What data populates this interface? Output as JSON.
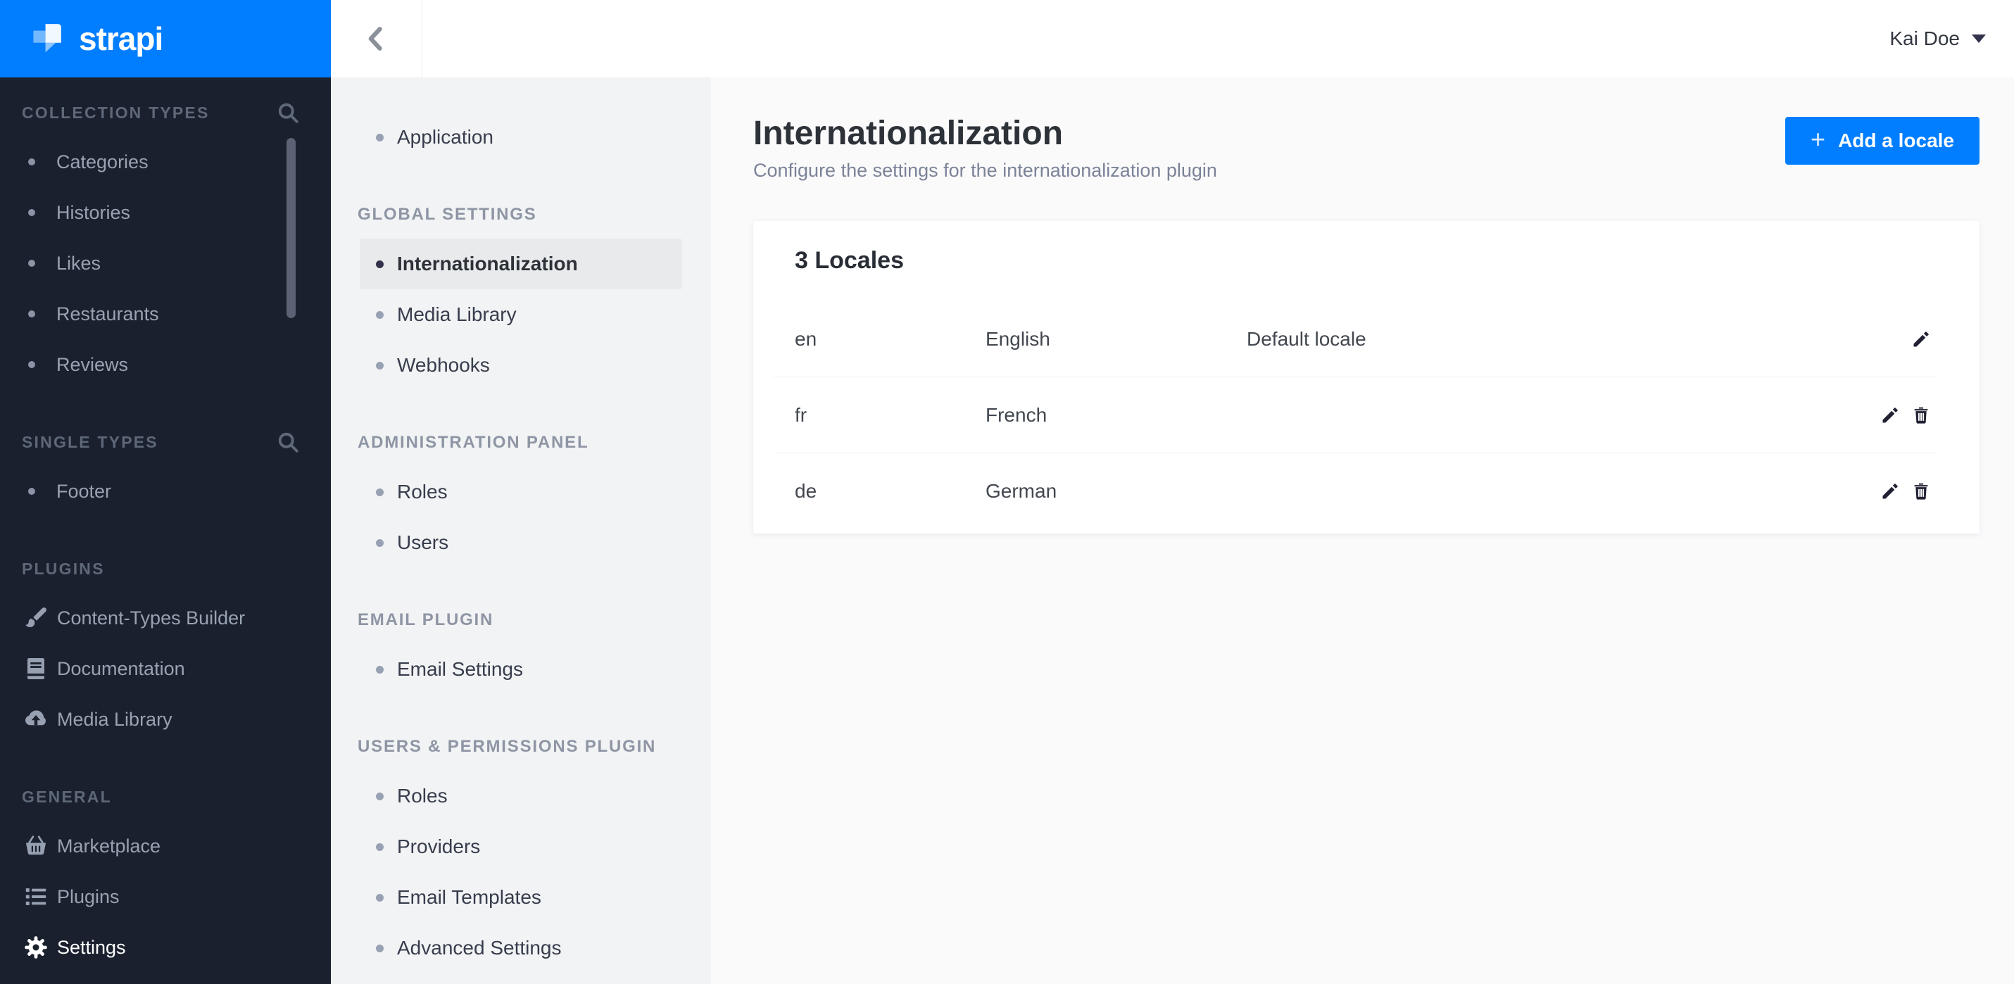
{
  "brand": {
    "name": "strapi"
  },
  "header": {
    "user": "Kai Doe"
  },
  "sidebar": {
    "sections": [
      {
        "label": "COLLECTION TYPES",
        "search_icon": "search-icon",
        "items": [
          {
            "label": "Categories"
          },
          {
            "label": "Histories"
          },
          {
            "label": "Likes"
          },
          {
            "label": "Restaurants"
          },
          {
            "label": "Reviews"
          }
        ]
      },
      {
        "label": "SINGLE TYPES",
        "search_icon": "search-icon",
        "items": [
          {
            "label": "Footer"
          }
        ]
      },
      {
        "label": "PLUGINS",
        "items": [
          {
            "label": "Content-Types Builder",
            "icon": "paintbrush-icon"
          },
          {
            "label": "Documentation",
            "icon": "book-icon"
          },
          {
            "label": "Media Library",
            "icon": "cloud-upload-icon"
          }
        ]
      },
      {
        "label": "GENERAL",
        "items": [
          {
            "label": "Marketplace",
            "icon": "basket-icon"
          },
          {
            "label": "Plugins",
            "icon": "list-icon"
          },
          {
            "label": "Settings",
            "icon": "gear-icon",
            "active": true
          }
        ]
      }
    ]
  },
  "settings_nav": {
    "top_item": {
      "label": "Application"
    },
    "sections": [
      {
        "label": "GLOBAL SETTINGS",
        "items": [
          {
            "label": "Internationalization",
            "active": true
          },
          {
            "label": "Media Library"
          },
          {
            "label": "Webhooks"
          }
        ]
      },
      {
        "label": "ADMINISTRATION PANEL",
        "items": [
          {
            "label": "Roles"
          },
          {
            "label": "Users"
          }
        ]
      },
      {
        "label": "EMAIL PLUGIN",
        "items": [
          {
            "label": "Email Settings"
          }
        ]
      },
      {
        "label": "USERS & PERMISSIONS PLUGIN",
        "items": [
          {
            "label": "Roles"
          },
          {
            "label": "Providers"
          },
          {
            "label": "Email Templates"
          },
          {
            "label": "Advanced Settings"
          }
        ]
      }
    ]
  },
  "main": {
    "title": "Internationalization",
    "subtitle": "Configure the settings for the internationalization plugin",
    "add_button": {
      "plus": "+",
      "label": "Add a locale"
    },
    "card": {
      "title": "3 Locales",
      "rows": [
        {
          "code": "en",
          "name": "English",
          "note": "Default locale"
        },
        {
          "code": "fr",
          "name": "French",
          "note": ""
        },
        {
          "code": "de",
          "name": "German",
          "note": ""
        }
      ]
    }
  },
  "colors": {
    "accent": "#007eff",
    "sidebar_bg": "#1a202e",
    "settings_nav_bg": "#f2f3f4",
    "active_item_bg": "#e9eaeb",
    "main_bg": "#fafafb"
  }
}
